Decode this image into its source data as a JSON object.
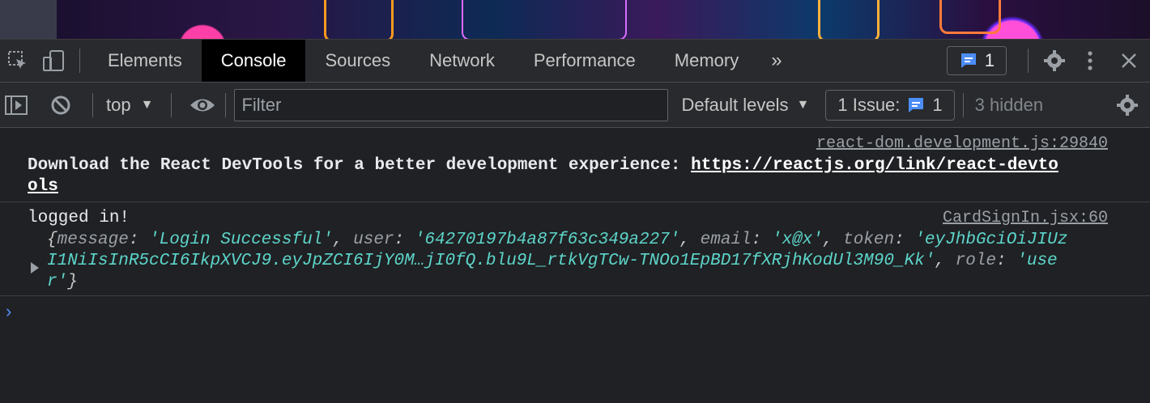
{
  "tabs": [
    {
      "label": "Elements"
    },
    {
      "label": "Console"
    },
    {
      "label": "Sources"
    },
    {
      "label": "Network"
    },
    {
      "label": "Performance"
    },
    {
      "label": "Memory"
    }
  ],
  "tab_more": "»",
  "header_issue_count": "1",
  "toolbar": {
    "context": "top",
    "filter_placeholder": "Filter",
    "levels": "Default levels",
    "issues_label": "1 Issue:",
    "issues_count": "1",
    "hidden": "3 hidden"
  },
  "messages": [
    {
      "source": "react-dom.development.js:29840",
      "text": "Download the React DevTools for a better development experience: ",
      "link_line1": "https://reactjs.org/link/react-devto",
      "link_line2": "ols"
    },
    {
      "source": "CardSignIn.jsx:60",
      "text": "logged in!",
      "obj": {
        "k_message": "message",
        "v_message": "'Login Successful'",
        "k_user": "user",
        "v_user": "'64270197b4a87f63c349a227'",
        "k_email": "email",
        "v_email": "'x@x'",
        "k_token": "token",
        "v_token_1": "'eyJhbGciOiJIUz",
        "v_token_2": "I1NiIsInR5cCI6IkpXVCJ9.eyJpZCI6IjY0M…jI0fQ.blu9L_rtkVgTCw-TNOo1EpBD17fXRjhKodUl3M90_Kk'",
        "k_role": "role",
        "v_role_1": "'use",
        "v_role_2": "r'"
      }
    }
  ],
  "colors": {
    "accent": "#8ab4f8",
    "string": "#5cd5ca",
    "prompt": "#4c8df6"
  }
}
